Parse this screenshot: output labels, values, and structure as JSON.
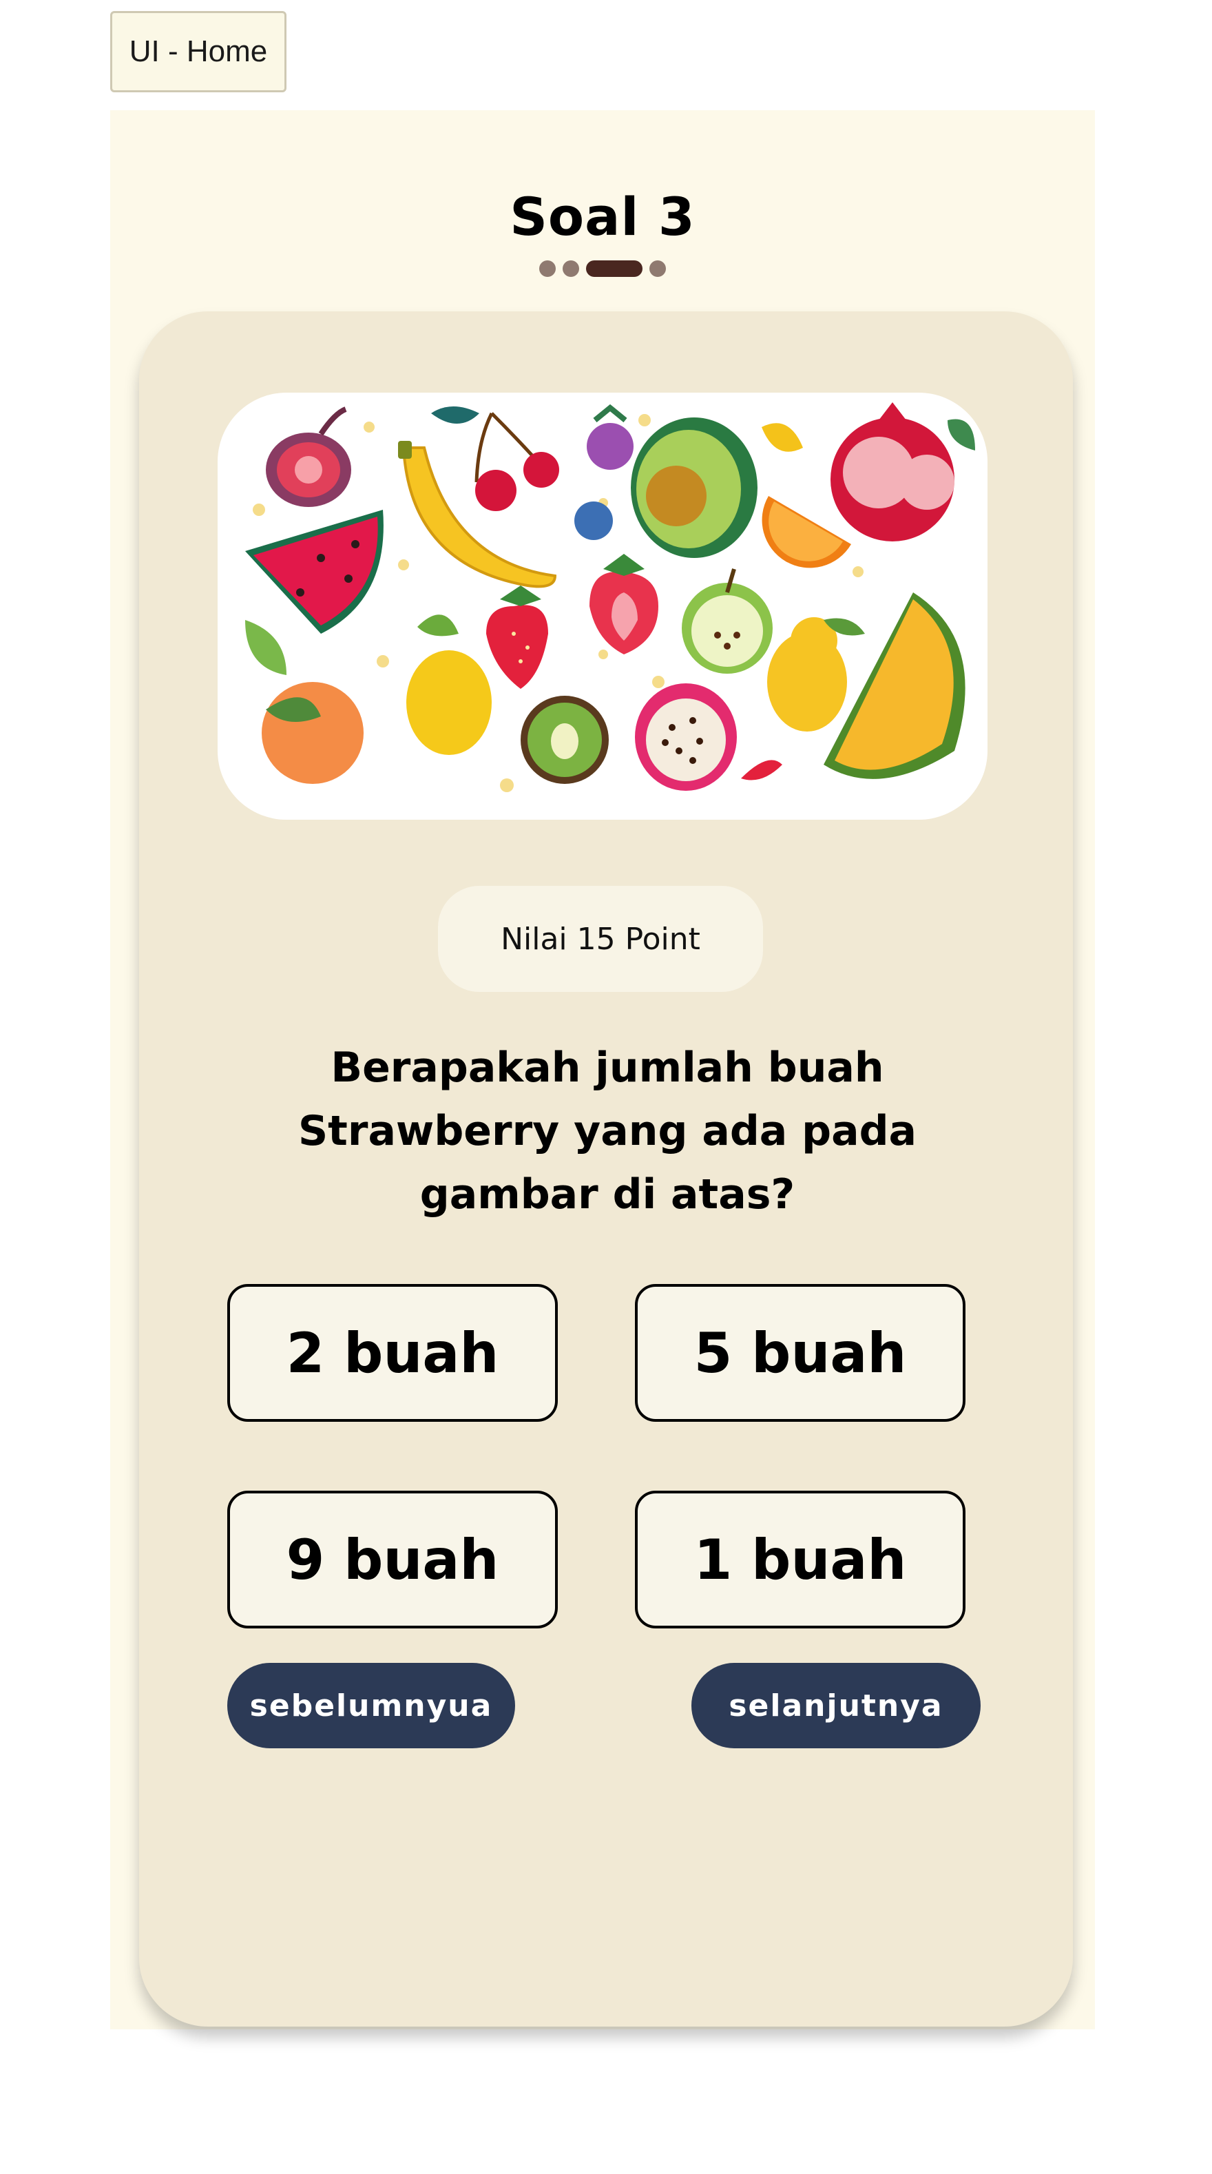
{
  "tab": {
    "label": "UI - Home"
  },
  "quiz": {
    "title": "Soal 3",
    "progress": {
      "total": 4,
      "current": 3
    },
    "points": "Nilai 15 Point",
    "question": "Berapakah jumlah buah Strawberry yang ada pada gambar di atas?",
    "answers": [
      "2 buah",
      "5 buah",
      "9 buah",
      "1 buah"
    ],
    "prev_label": "sebelumnyua",
    "next_label": "selanjutnya"
  },
  "colors": {
    "page_background": "#fdf9e9",
    "card_background": "#f1e9d4",
    "button_navy": "#2c3a56",
    "progress_active": "#4a2720",
    "progress_inactive": "#8f7a70"
  }
}
